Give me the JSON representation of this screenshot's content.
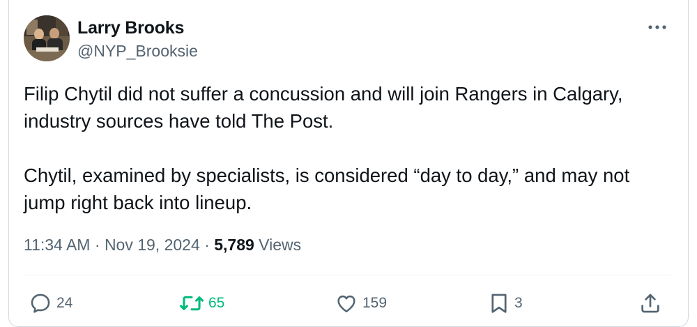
{
  "author": {
    "display_name": "Larry Brooks",
    "handle": "@NYP_Brooksie",
    "avatar_icon": "profile-photo"
  },
  "tweet": {
    "paragraphs": [
      "Filip Chytil did not suffer a concussion and will join Rangers in Calgary, industry sources have told The Post.",
      "Chytil, examined by specialists, is considered “day to day,” and may not jump right back into lineup."
    ],
    "time": "11:34 AM",
    "separator": "·",
    "date": "Nov 19, 2024",
    "views_count": "5,789",
    "views_label": "Views"
  },
  "actions": {
    "replies": "24",
    "reposts": "65",
    "likes": "159",
    "bookmarks": "3"
  },
  "colors": {
    "text_primary": "#0f1419",
    "text_secondary": "#536471",
    "repost_active": "#00ba7c",
    "border": "#cfd9de"
  }
}
